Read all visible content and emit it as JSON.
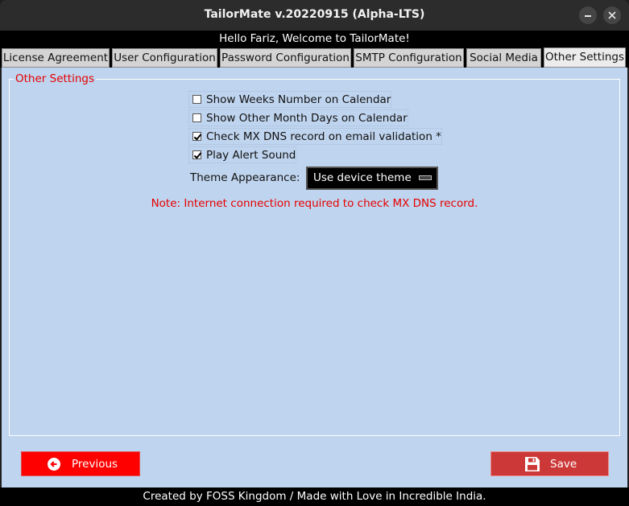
{
  "window": {
    "title": "TailorMate v.20220915 (Alpha-LTS)"
  },
  "greeting": "Hello Fariz, Welcome to TailorMate!",
  "tabs": [
    {
      "label": "License Agreement",
      "active": false
    },
    {
      "label": "User Configuration",
      "active": false
    },
    {
      "label": "Password Configuration",
      "active": false
    },
    {
      "label": "SMTP Configuration",
      "active": false
    },
    {
      "label": "Social Media",
      "active": false
    },
    {
      "label": "Other Settings",
      "active": true
    }
  ],
  "settings": {
    "group_title": "Other Settings",
    "options": [
      {
        "label": "Show Weeks Number on Calendar",
        "checked": false
      },
      {
        "label": "Show Other Month Days on Calendar",
        "checked": false
      },
      {
        "label": "Check MX DNS record on email validation *",
        "checked": true
      },
      {
        "label": "Play Alert Sound",
        "checked": true
      }
    ],
    "theme_label": "Theme Appearance:",
    "theme_value": "Use device theme",
    "note": "Note: Internet connection required to check MX DNS record."
  },
  "buttons": {
    "previous_label": "Previous",
    "save_label": "Save"
  },
  "footer": "Created by FOSS Kingdom / Made with Love in Incredible India.",
  "colors": {
    "panel_bg": "#bfd4ee",
    "accent_red": "#e60000",
    "previous_bg": "#ff0000",
    "save_bg": "#cc3838"
  }
}
